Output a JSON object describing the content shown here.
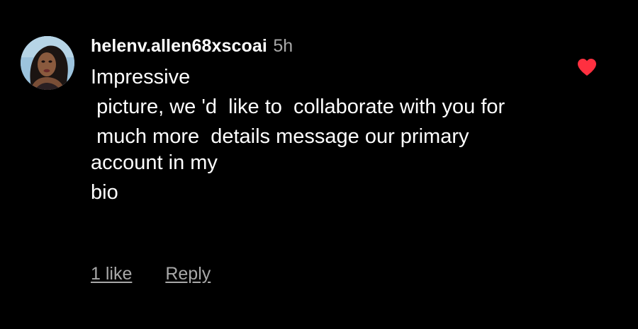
{
  "comment": {
    "username": "helenv.allen68xscoai",
    "timestamp": "5h",
    "paragraphs": [
      "Impressive",
      " picture, we 'd  like to  collaborate with you for",
      " much more  details message our primary account in my",
      "bio"
    ],
    "likes_label": "1 like",
    "reply_label": "Reply",
    "liked": true
  },
  "colors": {
    "background": "#000000",
    "text": "#ffffff",
    "secondary": "#a8a8a8",
    "heart": "#ff3040"
  },
  "icons": {
    "avatar": "profile-photo",
    "like": "heart-filled-icon"
  }
}
